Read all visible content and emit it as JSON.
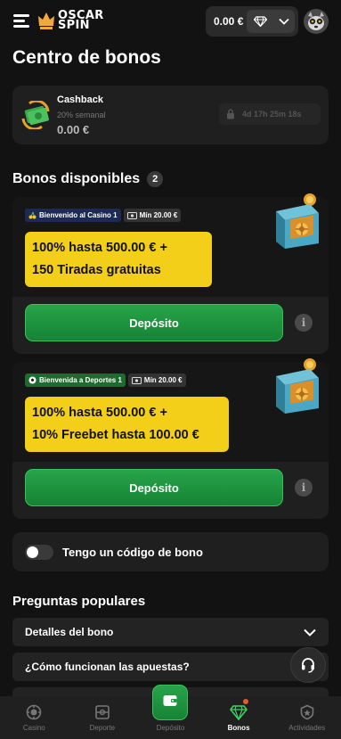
{
  "header": {
    "brand_line1": "OSCAR",
    "brand_line2": "SPIN",
    "balance": "0.00 €"
  },
  "page_title": "Centro de bonos",
  "cashback": {
    "title": "Cashback",
    "subtitle": "20% semanal",
    "amount": "0.00 €",
    "timer": "4d 17h 25m 18s"
  },
  "available": {
    "title": "Bonos disponibles",
    "count": "2"
  },
  "bonuses": [
    {
      "tag": "Bienvenido al Casino 1",
      "min": "Mín 20.00 €",
      "line1": "100% hasta 500.00 € +",
      "line2": "150 Tiradas gratuitas",
      "button": "Depósito"
    },
    {
      "tag": "Bienvenida a Deportes 1",
      "min": "Mín 20.00 €",
      "line1": "100% hasta 500.00 € +",
      "line2": "10% Freebet hasta 100.00 €",
      "button": "Depósito"
    }
  ],
  "bonus_code": {
    "label": "Tengo un código de bono",
    "enabled": false
  },
  "faq": {
    "title": "Preguntas populares",
    "items": [
      "Detalles del bono",
      "¿Cómo funcionan las apuestas?"
    ]
  },
  "nav": {
    "items": [
      {
        "label": "Casino",
        "icon": "casino-chip-icon"
      },
      {
        "label": "Deporte",
        "icon": "sports-field-icon"
      },
      {
        "label": "Depósito",
        "icon": "wallet-icon"
      },
      {
        "label": "Bonos",
        "icon": "diamond-icon"
      },
      {
        "label": "Actividades",
        "icon": "badge-icon"
      }
    ],
    "active": "Bonos"
  },
  "colors": {
    "background": "#121212",
    "card": "#1f1f1f",
    "promo_yellow": "#f4cf19",
    "deposit_green": "#1f9a41",
    "notification": "#e85a2a"
  }
}
